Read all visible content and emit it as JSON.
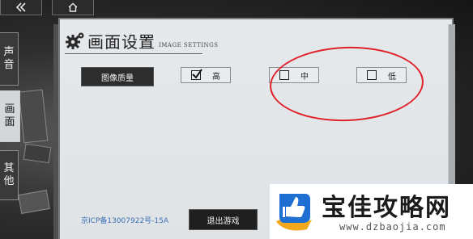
{
  "tabs": [
    {
      "chars": [
        "声",
        "音"
      ]
    },
    {
      "chars": [
        "画",
        "面"
      ]
    },
    {
      "chars": [
        "其",
        "他"
      ]
    }
  ],
  "header": {
    "title": "画面设置",
    "subtitle": "IMAGE SETTINGS"
  },
  "quality": {
    "label": "图像质量",
    "options": [
      {
        "label": "高",
        "checked": true
      },
      {
        "label": "中",
        "checked": false
      },
      {
        "label": "低",
        "checked": false
      }
    ]
  },
  "footer": {
    "icp": "京ICP备13007922号-15A",
    "exit_label": "退出游戏"
  },
  "watermark": {
    "title": "宝佳攻略网",
    "url": "www.dzbaojia.com"
  },
  "colors": {
    "annotation_oval": "#e0222a",
    "icp_link": "#3b6fb5"
  },
  "icons": {
    "top_left": "back-double-chevron-icon",
    "top_home": "home-icon",
    "header": "gear-icon"
  }
}
